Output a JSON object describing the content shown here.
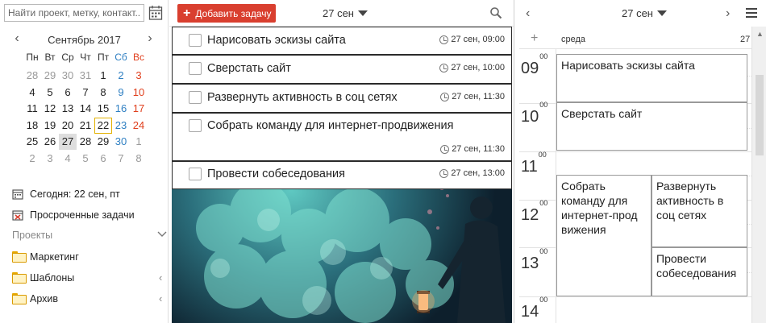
{
  "search": {
    "placeholder": "Найти проект, метку, контакт..."
  },
  "calendar": {
    "month_title": "Сентябрь 2017",
    "prev_icon": "chevron-left-icon",
    "next_icon": "chevron-right-icon",
    "weekdays": [
      "Пн",
      "Вт",
      "Ср",
      "Чт",
      "Пт",
      "Сб",
      "Вс"
    ],
    "weeks": [
      [
        "28",
        "29",
        "30",
        "31",
        "1",
        "2",
        "3"
      ],
      [
        "4",
        "5",
        "6",
        "7",
        "8",
        "9",
        "10"
      ],
      [
        "11",
        "12",
        "13",
        "14",
        "15",
        "16",
        "17"
      ],
      [
        "18",
        "19",
        "20",
        "21",
        "22",
        "23",
        "24"
      ],
      [
        "25",
        "26",
        "27",
        "28",
        "29",
        "30",
        "1"
      ],
      [
        "2",
        "3",
        "4",
        "5",
        "6",
        "7",
        "8"
      ]
    ],
    "today": "22",
    "selected": "27",
    "colors": {
      "weekend_sun": "#e0401e",
      "weekend_sat": "#2e7fc2",
      "today_border": "#e2b100"
    }
  },
  "left_nav": {
    "today_label": "Сегодня: 22 сен, пт",
    "overdue_label": "Просроченные задачи",
    "projects_label": "Проекты",
    "projects": [
      {
        "label": "Маркетинг",
        "has_children": false
      },
      {
        "label": "Шаблоны",
        "has_children": true
      },
      {
        "label": "Архив",
        "has_children": true
      }
    ]
  },
  "middle": {
    "add_task_label": "Добавить задачу",
    "date_label": "27 сен",
    "accent": "#d93f2f",
    "tasks": [
      {
        "title": "Нарисовать эскизы сайта",
        "time": "27 сен, 09:00"
      },
      {
        "title": "Сверстать сайт",
        "time": "27 сен, 10:00"
      },
      {
        "title": "Развернуть активность в соц сетях",
        "time": "27 сен, 11:30"
      },
      {
        "title": "Собрать команду для интернет-продвижения",
        "time": "27 сен, 11:30"
      },
      {
        "title": "Провести собеседования",
        "time": "27 сен, 13:00"
      }
    ]
  },
  "right": {
    "date_label": "27 сен",
    "day_name": "среда",
    "day_number": "27",
    "add_icon": "+",
    "hours": [
      "09",
      "10",
      "11",
      "12",
      "13",
      "14"
    ],
    "hour_suffix": "00",
    "events": [
      {
        "title": "Нарисовать эскизы сайта"
      },
      {
        "title": "Сверстать сайт"
      },
      {
        "title": "Собрать команду для интернет-прод вижения"
      },
      {
        "title": "Развернуть активность в соц сетях"
      },
      {
        "title": "Провести собеседования"
      }
    ]
  }
}
